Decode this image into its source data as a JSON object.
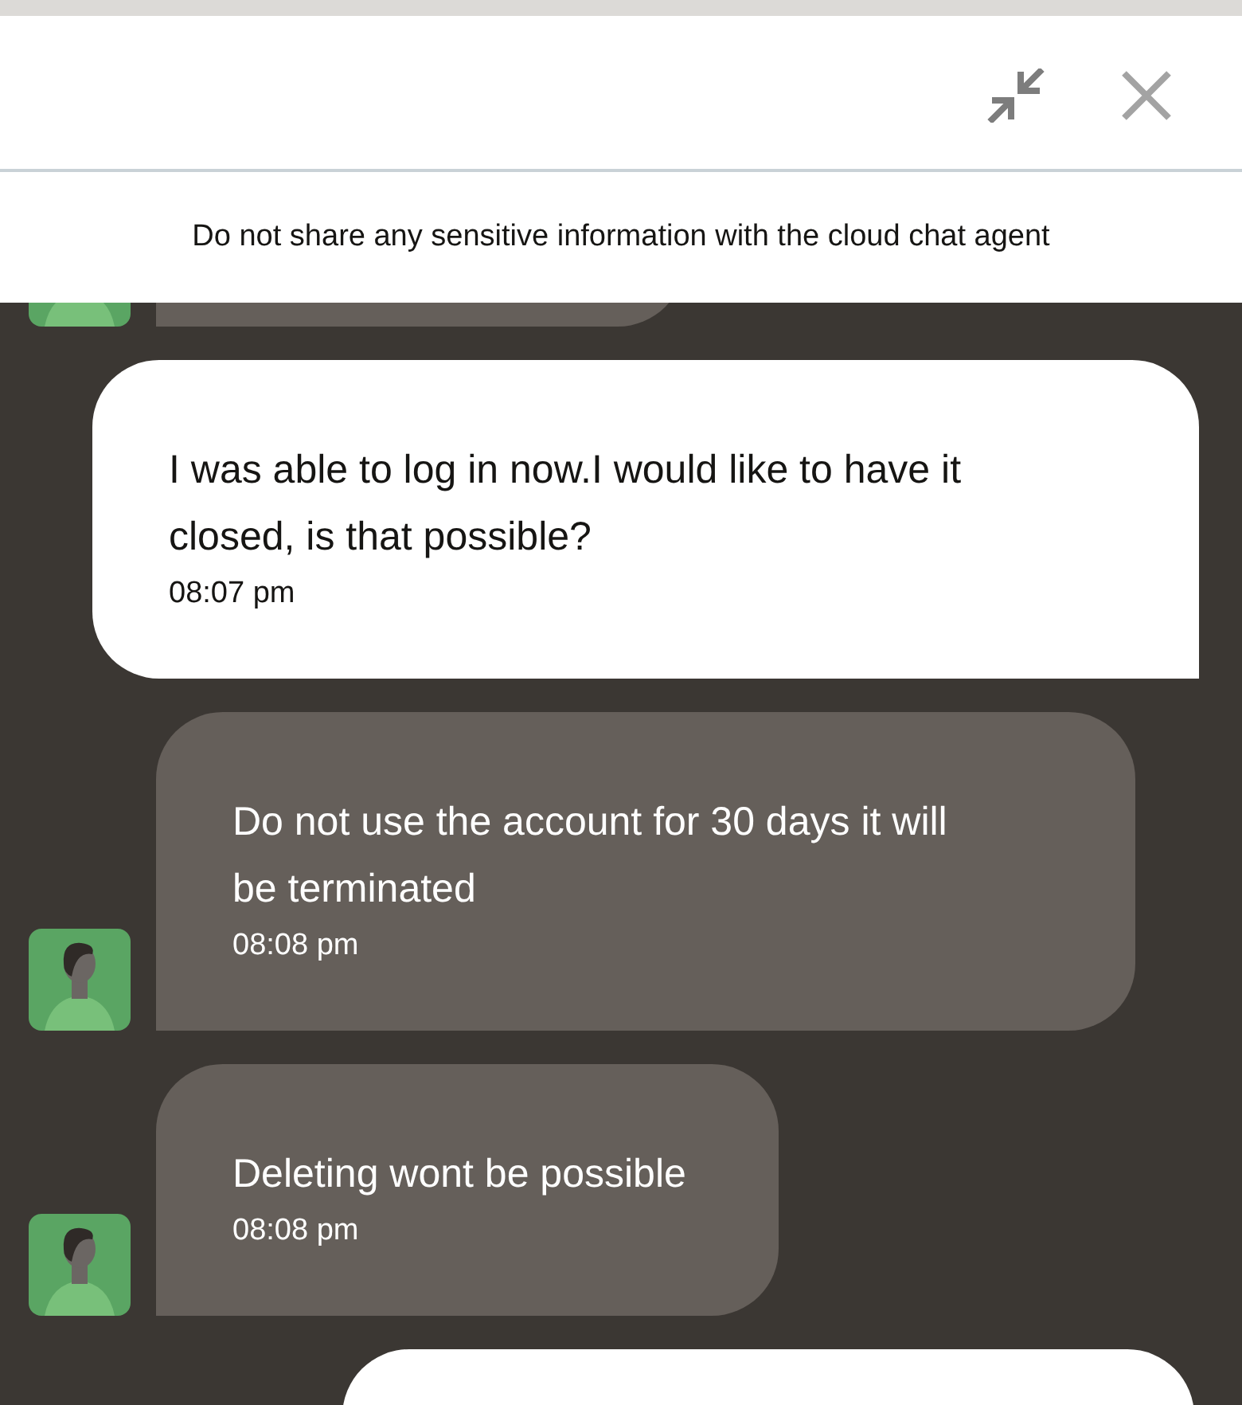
{
  "header": {
    "buttons": [
      {
        "kind": "minimize"
      },
      {
        "kind": "close"
      }
    ]
  },
  "notice": "Do not share any sensitive information with the cloud chat agent",
  "messages": [
    {
      "kind": "agent"
    },
    {
      "kind": "user",
      "text": "I was able to log in now.I would like to have it closed, is that possible?",
      "time": "08:07 pm"
    },
    {
      "kind": "agent",
      "text": "Do not use the account for 30 days it will be terminated",
      "time": "08:08 pm"
    },
    {
      "kind": "agent",
      "text": "Deleting wont be possible",
      "time": "08:08 pm"
    },
    {
      "kind": "user"
    }
  ]
}
